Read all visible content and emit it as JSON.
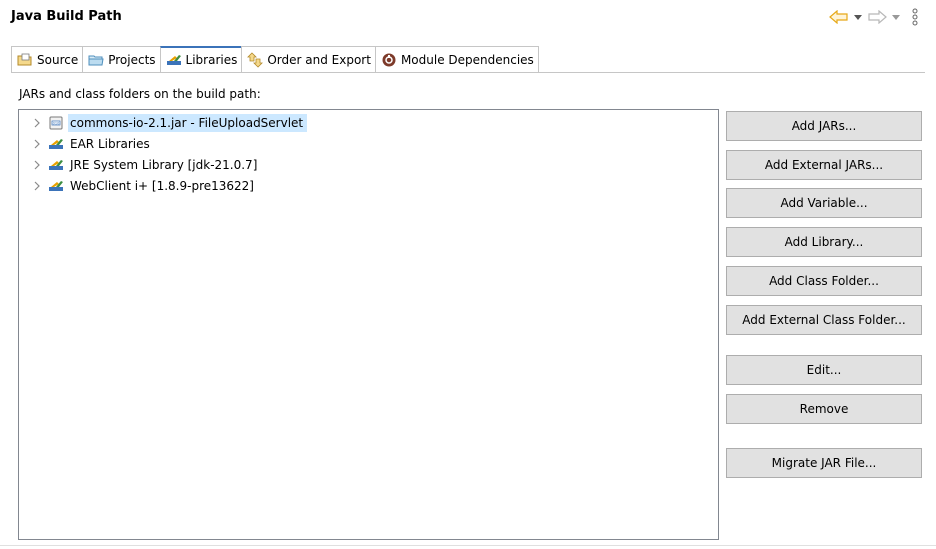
{
  "header": {
    "title": "Java Build Path"
  },
  "nav": {
    "back_icon": "back-arrow-icon",
    "forward_icon": "forward-arrow-icon",
    "menu_icon": "view-menu-icon"
  },
  "tabs": [
    {
      "label": "Source",
      "icon": "source-folder-icon",
      "active": false
    },
    {
      "label": "Projects",
      "icon": "projects-icon",
      "active": false
    },
    {
      "label": "Libraries",
      "icon": "libraries-icon",
      "active": true
    },
    {
      "label": "Order and Export",
      "icon": "order-export-icon",
      "active": false
    },
    {
      "label": "Module Dependencies",
      "icon": "module-icon",
      "active": false
    }
  ],
  "main": {
    "path_label": "JARs and class folders on the build path:",
    "tree": [
      {
        "label": "commons-io-2.1.jar - FileUploadServlet",
        "icon": "jar-icon",
        "selected": true
      },
      {
        "label": "EAR Libraries",
        "icon": "library-icon",
        "selected": false
      },
      {
        "label": "JRE System Library [jdk-21.0.7]",
        "icon": "library-icon",
        "selected": false
      },
      {
        "label": "WebClient i+ [1.8.9-pre13622]",
        "icon": "library-icon",
        "selected": false
      }
    ]
  },
  "buttons": {
    "add_jars": "Add JARs...",
    "add_external_jars": "Add External JARs...",
    "add_variable": "Add Variable...",
    "add_library": "Add Library...",
    "add_class_folder": "Add Class Folder...",
    "add_external_class_folder": "Add External Class Folder...",
    "edit": "Edit...",
    "remove": "Remove",
    "migrate_jar": "Migrate JAR File..."
  },
  "colors": {
    "accent": "#3b73b9",
    "selection": "#cce8ff",
    "button_bg": "#e1e1e1",
    "nav_arrow": "#e6a817"
  }
}
